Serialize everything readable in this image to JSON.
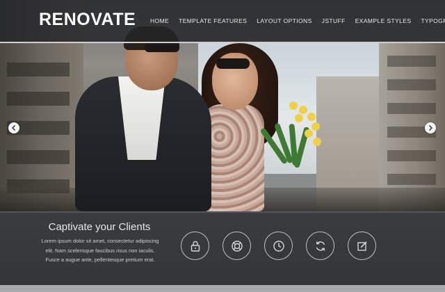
{
  "site": {
    "logo": "RENOVATE"
  },
  "nav": {
    "items": [
      {
        "label": "HOME"
      },
      {
        "label": "TEMPLATE FEATURES"
      },
      {
        "label": "LAYOUT OPTIONS"
      },
      {
        "label": "JSTUFF"
      },
      {
        "label": "EXAMPLE STYLES"
      },
      {
        "label": "TYPOGRAPHY"
      }
    ]
  },
  "slider": {
    "prev_icon": "chevron-left-icon",
    "next_icon": "chevron-right-icon"
  },
  "feature_panel": {
    "title": "Captivate your Clients",
    "text": "Lorem ipsum dolor sit amet, consectetur adipiscing elit. Nam scelerisque faucibus risus non iaculis. Fusce a augue ante, pellentesque pretium erat.",
    "icons": [
      {
        "name": "lock-icon"
      },
      {
        "name": "lifebuoy-icon"
      },
      {
        "name": "clock-icon"
      },
      {
        "name": "refresh-icon"
      },
      {
        "name": "edit-icon"
      }
    ]
  },
  "colors": {
    "header_bg": "#232428",
    "panel_bg": "#3b3c40",
    "text_light": "#e6e6e6",
    "icon_stroke": "#bfc0c2"
  }
}
